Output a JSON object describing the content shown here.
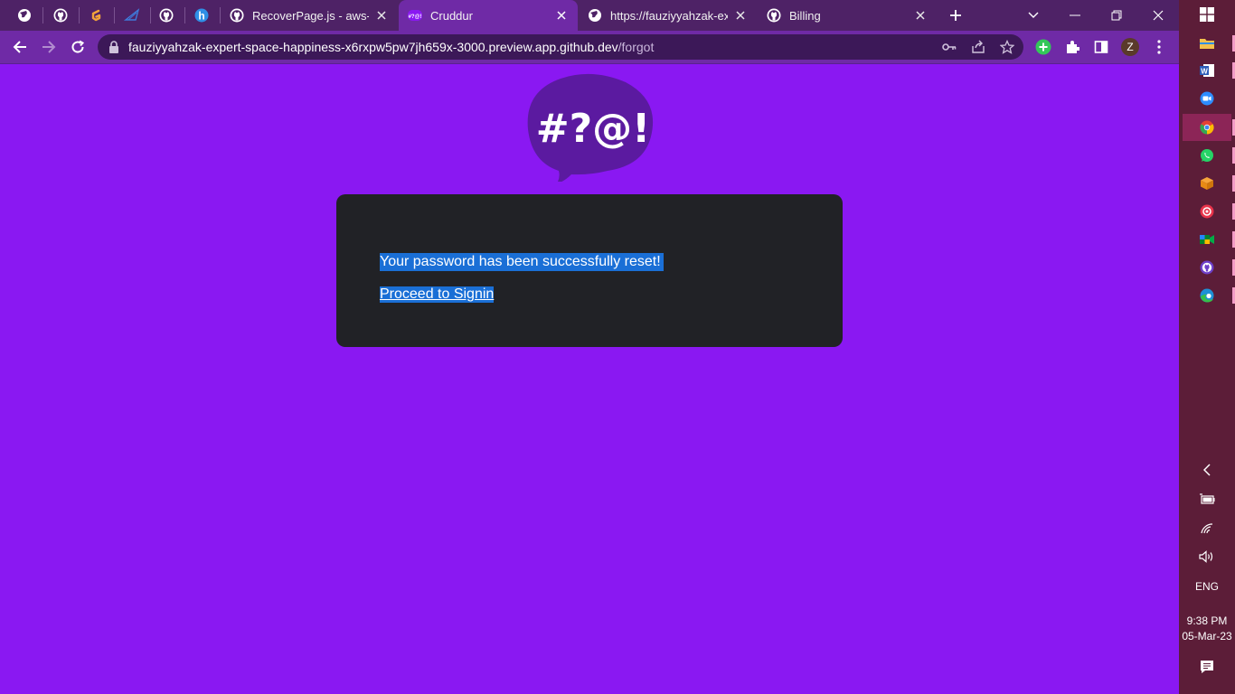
{
  "browser": {
    "tabs": [
      {
        "title": "RecoverPage.js - aws-boo",
        "icon": "github-icon"
      },
      {
        "title": "Cruddur",
        "icon": "cruddur-icon",
        "active": true
      },
      {
        "title": "https://fauziyyahzak-expe",
        "icon": "globe-icon"
      },
      {
        "title": "Billing",
        "icon": "github-icon"
      }
    ],
    "pinned_icons": [
      "globe-icon",
      "github-icon",
      "gitpod-icon",
      "sail-icon",
      "github-icon",
      "hashnode-icon"
    ],
    "url_host": "fauziyyahzak-expert-space-happiness-x6rxpw5pw7jh659x-3000.preview.app.github.dev",
    "url_path": "/forgot",
    "profile_initial": "Z"
  },
  "page": {
    "logo_text": "#?@!",
    "message": "Your password has been successfully reset!",
    "proceed_link": "Proceed to Signin"
  },
  "taskbar": {
    "apps": [
      "windows-start-icon",
      "file-explorer-icon",
      "word-icon",
      "zoom-icon",
      "chrome-icon",
      "whatsapp-icon",
      "box-icon",
      "screen-recorder-icon",
      "meet-icon",
      "github-desktop-icon",
      "edge-icon"
    ],
    "language": "ENG",
    "time": "9:38 PM",
    "date": "05-Mar-23"
  },
  "colors": {
    "page_background": "#8a18f2",
    "card_background": "#212226",
    "selection": "#1a6fd6",
    "tab_strip": "#4e2266",
    "toolbar": "#6f2aa6",
    "taskbar": "#5c1d38"
  }
}
